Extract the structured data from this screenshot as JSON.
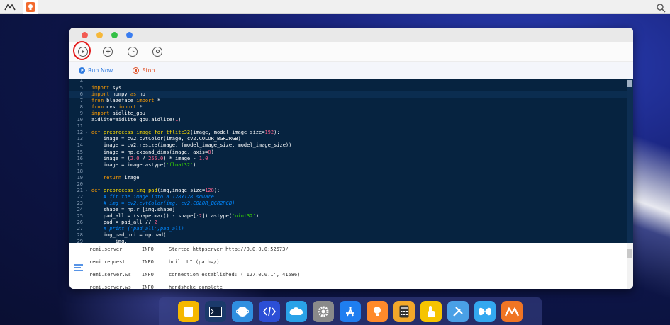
{
  "toolbar": {
    "run_label": "Run Now",
    "stop_label": "Stop"
  },
  "colors": {
    "accent_run": "#2d7ae0",
    "accent_stop": "#e0532a",
    "highlight": "#e31818",
    "editor_bg": "#062340"
  },
  "editor": {
    "lines": [
      {
        "n": "4",
        "fold": "",
        "segs": [
          [
            "",
            ""
          ]
        ]
      },
      {
        "n": "5",
        "fold": "",
        "segs": [
          [
            "kw",
            "import"
          ],
          [
            "",
            " sys"
          ]
        ]
      },
      {
        "n": "6",
        "fold": "",
        "current": true,
        "segs": [
          [
            "kw",
            "import"
          ],
          [
            "",
            " numpy "
          ],
          [
            "kw",
            "as"
          ],
          [
            "",
            " np"
          ]
        ]
      },
      {
        "n": "7",
        "fold": "",
        "segs": [
          [
            "kw",
            "from"
          ],
          [
            "",
            " blazeface "
          ],
          [
            "kw",
            "import"
          ],
          [
            "",
            " *"
          ]
        ]
      },
      {
        "n": "8",
        "fold": "",
        "segs": [
          [
            "kw",
            "from"
          ],
          [
            "",
            " cvs "
          ],
          [
            "kw",
            "import"
          ],
          [
            "",
            " *"
          ]
        ]
      },
      {
        "n": "9",
        "fold": "",
        "segs": [
          [
            "kw",
            "import"
          ],
          [
            "",
            " aidlite_gpu"
          ]
        ]
      },
      {
        "n": "10",
        "fold": "",
        "segs": [
          [
            "",
            "aidlite=aidlite_gpu.aidlite("
          ],
          [
            "num",
            "1"
          ],
          [
            "",
            ")"
          ]
        ]
      },
      {
        "n": "11",
        "fold": "",
        "segs": [
          [
            "",
            ""
          ]
        ]
      },
      {
        "n": "12",
        "fold": "▾",
        "segs": [
          [
            "kw",
            "def"
          ],
          [
            "",
            " "
          ],
          [
            "fn",
            "preprocess_image_for_tflite32"
          ],
          [
            "",
            "(image, model_image_size="
          ],
          [
            "num",
            "192"
          ],
          [
            "",
            "):"
          ]
        ]
      },
      {
        "n": "13",
        "fold": "",
        "segs": [
          [
            "",
            "    image = cv2.cvtColor(image, cv2.COLOR_BGR2RGB)"
          ]
        ]
      },
      {
        "n": "14",
        "fold": "",
        "segs": [
          [
            "",
            "    image = cv2.resize(image, (model_image_size, model_image_size))"
          ]
        ]
      },
      {
        "n": "15",
        "fold": "",
        "segs": [
          [
            "",
            "    image = np.expand_dims(image, axis="
          ],
          [
            "num",
            "0"
          ],
          [
            "",
            ")"
          ]
        ]
      },
      {
        "n": "16",
        "fold": "",
        "segs": [
          [
            "",
            "    image = ("
          ],
          [
            "num",
            "2.0"
          ],
          [
            "",
            " / "
          ],
          [
            "num",
            "255.0"
          ],
          [
            "",
            ") * image - "
          ],
          [
            "num",
            "1.0"
          ]
        ]
      },
      {
        "n": "17",
        "fold": "",
        "segs": [
          [
            "",
            "    image = image.astype("
          ],
          [
            "str",
            "'float32'"
          ],
          [
            "",
            ")"
          ]
        ]
      },
      {
        "n": "18",
        "fold": "",
        "segs": [
          [
            "",
            ""
          ]
        ]
      },
      {
        "n": "19",
        "fold": "",
        "segs": [
          [
            "",
            "    "
          ],
          [
            "kw",
            "return"
          ],
          [
            "",
            " image"
          ]
        ]
      },
      {
        "n": "20",
        "fold": "",
        "segs": [
          [
            "",
            ""
          ]
        ]
      },
      {
        "n": "21",
        "fold": "▾",
        "segs": [
          [
            "kw",
            "def"
          ],
          [
            "",
            " "
          ],
          [
            "fn",
            "preprocess_img_pad"
          ],
          [
            "",
            "(img,image_size="
          ],
          [
            "num",
            "128"
          ],
          [
            "",
            "):"
          ]
        ]
      },
      {
        "n": "22",
        "fold": "",
        "segs": [
          [
            "",
            "    "
          ],
          [
            "cm",
            "# fit the image into a 128x128 square"
          ]
        ]
      },
      {
        "n": "23",
        "fold": "",
        "segs": [
          [
            "",
            "    "
          ],
          [
            "cm",
            "# img = cv2.cvtColor(img, cv2.COLOR_BGR2RGB)"
          ]
        ]
      },
      {
        "n": "24",
        "fold": "",
        "segs": [
          [
            "",
            "    shape = np.r_[img.shape]"
          ]
        ]
      },
      {
        "n": "25",
        "fold": "",
        "segs": [
          [
            "",
            "    pad_all = (shape.max() - shape[:"
          ],
          [
            "num",
            "2"
          ],
          [
            "",
            "]).astype("
          ],
          [
            "str",
            "'uint32'"
          ],
          [
            "",
            ")"
          ]
        ]
      },
      {
        "n": "26",
        "fold": "",
        "segs": [
          [
            "",
            "    pad = pad_all // "
          ],
          [
            "num",
            "2"
          ]
        ]
      },
      {
        "n": "27",
        "fold": "",
        "segs": [
          [
            "",
            "    "
          ],
          [
            "cm",
            "# print ('pad_all',pad_all)"
          ]
        ]
      },
      {
        "n": "28",
        "fold": "",
        "segs": [
          [
            "",
            "    img_pad_ori = np.pad("
          ]
        ]
      },
      {
        "n": "29",
        "fold": "",
        "segs": [
          [
            "",
            "        img,"
          ]
        ]
      }
    ]
  },
  "log": {
    "rows": [
      {
        "src": "remi.server",
        "lvl": "INFO",
        "msg": "Started httpserver http://0.0.0.0:52573/"
      },
      {
        "src": "remi.request",
        "lvl": "INFO",
        "msg": "built UI (path=/)"
      },
      {
        "src": "remi.server.ws",
        "lvl": "INFO",
        "msg": "connection established: ('127.0.0.1', 41586)"
      },
      {
        "src": "remi.server.ws",
        "lvl": "INFO",
        "msg": "handshake complete"
      }
    ]
  },
  "dock": {
    "apps": [
      {
        "name": "files-app-icon",
        "bg": "#f5b800"
      },
      {
        "name": "terminal-app-icon",
        "bg": "#1b3a6b"
      },
      {
        "name": "browser-app-icon",
        "bg": "#2f8fe0"
      },
      {
        "name": "code-editor-app-icon",
        "bg": "#2c4fd6"
      },
      {
        "name": "cloud-app-icon",
        "bg": "#2aa2e8"
      },
      {
        "name": "settings-app-icon",
        "bg": "#8a8a8a"
      },
      {
        "name": "app-store-icon",
        "bg": "#1f7ef0"
      },
      {
        "name": "lightbulb-app-icon",
        "bg": "#ff8a2b"
      },
      {
        "name": "calculator-app-icon",
        "bg": "#f2a82a"
      },
      {
        "name": "touch-app-icon",
        "bg": "#f6c400"
      },
      {
        "name": "tools-app-icon",
        "bg": "#4aa0e6"
      },
      {
        "name": "butterfly-app-icon",
        "bg": "#33a8f0"
      },
      {
        "name": "aidlux-app-icon",
        "bg": "#f07524"
      }
    ]
  }
}
